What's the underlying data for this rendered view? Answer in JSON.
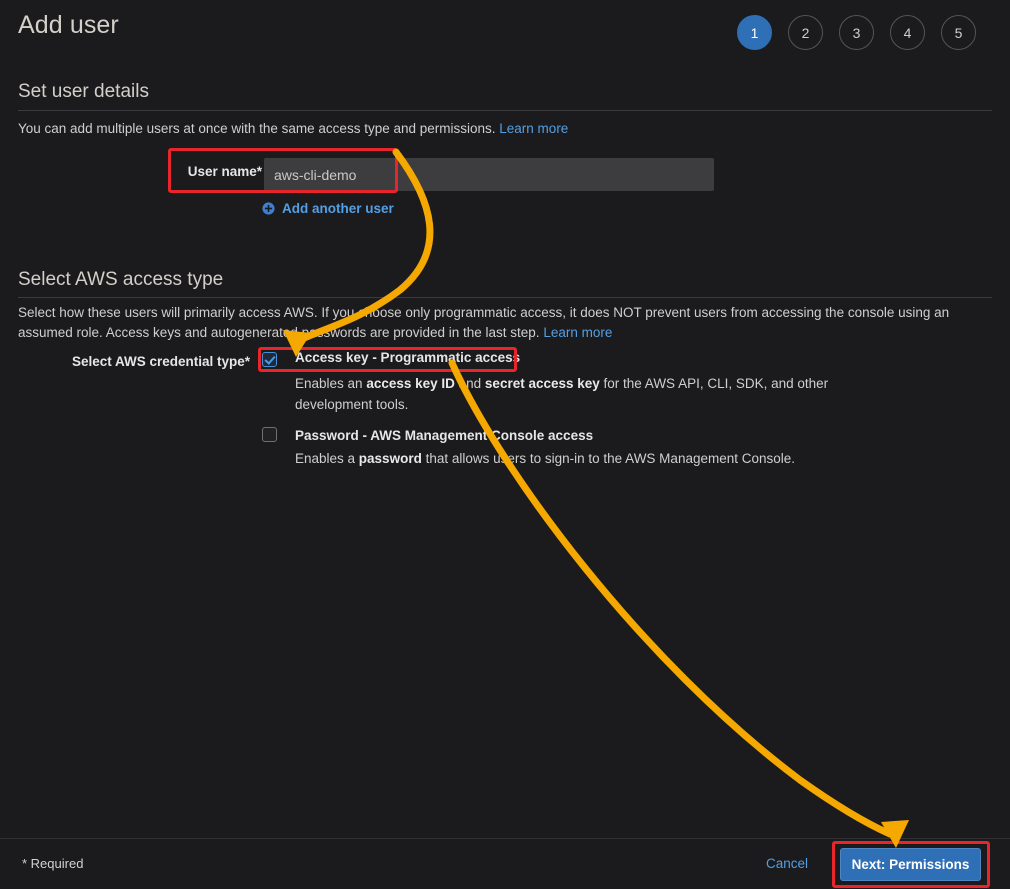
{
  "header": {
    "title": "Add user",
    "steps": [
      {
        "label": "1",
        "active": true
      },
      {
        "label": "2",
        "active": false
      },
      {
        "label": "3",
        "active": false
      },
      {
        "label": "4",
        "active": false
      },
      {
        "label": "5",
        "active": false
      }
    ]
  },
  "user_details": {
    "section_title": "Set user details",
    "description": "You can add multiple users at once with the same access type and permissions.",
    "learn_more": "Learn more",
    "username_label": "User name*",
    "username_value": "aws-cli-demo",
    "username_placeholder": "",
    "add_another_user": "Add another user"
  },
  "access_type": {
    "section_title": "Select AWS access type",
    "description_line1": "Select how these users will primarily access AWS. If you choose only programmatic access, it does NOT prevent users from accessing the console using",
    "description_line2": "an assumed role. Access keys and autogenerated passwords are provided in the last step.",
    "learn_more": "Learn more",
    "credential_type_label": "Select AWS credential type*",
    "options": [
      {
        "title": "Access key - Programmatic access",
        "checked": true,
        "description_html": "Enables an <b>access key ID</b> and <b>secret access key</b> for the AWS API, CLI, SDK, and other development tools."
      },
      {
        "title": "Password - AWS Management Console access",
        "checked": false,
        "description_html": "Enables a <b>password</b> that allows users to sign-in to the AWS Management Console."
      }
    ]
  },
  "footer": {
    "required_note": "* Required",
    "cancel_label": "Cancel",
    "next_label": "Next: Permissions"
  },
  "colors": {
    "accent_blue": "#2f6fb5",
    "link_blue": "#539fe5",
    "annotation_red": "#e8252a",
    "annotation_orange": "#f5a800",
    "background": "#1b1b1d"
  }
}
